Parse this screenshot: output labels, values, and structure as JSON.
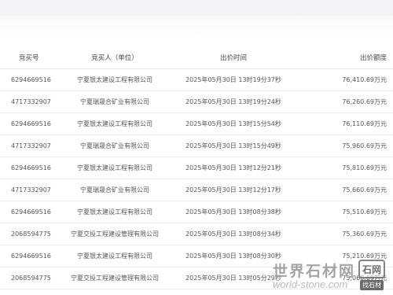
{
  "table": {
    "headers": [
      "竞买号",
      "竞买人（单位）",
      "出价时间",
      "出价额度"
    ],
    "rows": [
      {
        "bidder_no": "6294669516",
        "bidder": "宁夏银太建设工程有限公司",
        "time": "2025年05月30日 13时19分37秒",
        "amount": "76,410.69万元"
      },
      {
        "bidder_no": "4717332907",
        "bidder": "宁夏瑞晟合矿业有限公司",
        "time": "2025年05月30日 13时19分24秒",
        "amount": "76,260.69万元"
      },
      {
        "bidder_no": "6294669516",
        "bidder": "宁夏银太建设工程有限公司",
        "time": "2025年05月30日 13时15分54秒",
        "amount": "76,110.69万元"
      },
      {
        "bidder_no": "4717332907",
        "bidder": "宁夏瑞晟合矿业有限公司",
        "time": "2025年05月30日 13时15分49秒",
        "amount": "75,960.69万元"
      },
      {
        "bidder_no": "6294669516",
        "bidder": "宁夏银太建设工程有限公司",
        "time": "2025年05月30日 13时12分21秒",
        "amount": "75,810.69万元"
      },
      {
        "bidder_no": "4717332907",
        "bidder": "宁夏瑞晟合矿业有限公司",
        "time": "2025年05月30日 13时12分17秒",
        "amount": "75,660.69万元"
      },
      {
        "bidder_no": "6294669516",
        "bidder": "宁夏银太建设工程有限公司",
        "time": "2025年05月30日 13时08分38秒",
        "amount": "75,510.69万元"
      },
      {
        "bidder_no": "2068594775",
        "bidder": "宁夏交投工程建设管理有限公司",
        "time": "2025年05月30日 13时08分34秒",
        "amount": "75,360.69万元"
      },
      {
        "bidder_no": "6294669516",
        "bidder": "宁夏银太建设工程有限公司",
        "time": "2025年05月30日 13时08分30秒",
        "amount": "75,210.69万元"
      },
      {
        "bidder_no": "2068594775",
        "bidder": "宁夏交投工程建设管理有限公司",
        "time": "2025年05月30日 13时05分29秒",
        "amount": "75,060.69万元"
      }
    ]
  },
  "watermark": {
    "cn": "世界石材网",
    "en": "world-stone.com",
    "logo_top": "石网",
    "logo_bottom": "找石材"
  }
}
